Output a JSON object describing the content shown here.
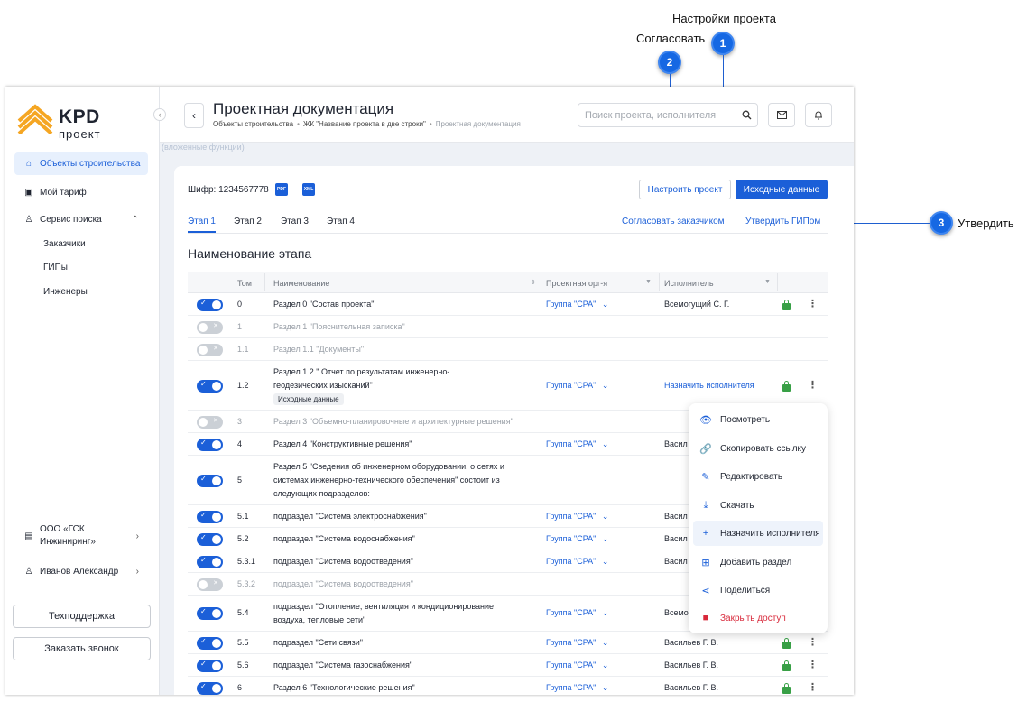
{
  "callouts": {
    "c1": {
      "num": "1",
      "label": "Настройки проекта"
    },
    "c2": {
      "num": "2",
      "label": "Согласовать"
    },
    "c3": {
      "num": "3",
      "label": "Утвердить"
    }
  },
  "sidebar": {
    "logo_text": "KPD",
    "logo_sub": "проект",
    "collapse_icon": "‹",
    "items": [
      {
        "label": "Объекты строительства"
      },
      {
        "label": "Мой тариф"
      },
      {
        "label": "Сервис поиска"
      }
    ],
    "sub_items": [
      "Заказчики",
      "ГИПы",
      "Инженеры"
    ],
    "company": {
      "line1": "ООО «ГСК",
      "line2": "Инжиниринг»"
    },
    "user": "Иванов Александр",
    "support_button": "Техподдержка",
    "call_button": "Заказать звонок"
  },
  "header": {
    "title": "Проектная документация",
    "breadcrumb": {
      "b1": "Объекты строительства",
      "b2": "ЖК \"Название проекта в две строки\"",
      "b3": "Проектная документация"
    },
    "search_placeholder": "Поиск проекта, исполнителя",
    "faded_text": "(вложенные функции)"
  },
  "card": {
    "cipher": "Шифр: 1234567778",
    "pdf_label": "PDF",
    "xml_label": "XML",
    "configure_button": "Настроить проект",
    "source_button": "Исходные данные",
    "tabs": [
      "Этап 1",
      "Этап 2",
      "Этап 3",
      "Этап 4"
    ],
    "agree_link": "Согласовать заказчиком",
    "approve_link": "Утвердить ГИПом",
    "stage_title": "Наименование этапа"
  },
  "table": {
    "headers": {
      "tom": "Том",
      "name": "Наименование",
      "org": "Проектная орг-я",
      "executor": "Исполнитель"
    },
    "sort_icon": "⇕",
    "filter_icon": "▼",
    "kebab": "⋮",
    "rows": [
      {
        "tom": "0",
        "name1": "Раздел 0 \"Состав проекта\"",
        "name2": "",
        "name3": "",
        "org": "Группа \"СРА\"",
        "exec": "Всемогущий С. Г.",
        "on": true
      },
      {
        "tom": "1",
        "name1": "Раздел 1 \"Пояснительная записка\"",
        "name2": "",
        "name3": "",
        "org": "",
        "exec": "",
        "on": false
      },
      {
        "tom": "1.1",
        "name1": "Раздел 1.1 \"Документы\"",
        "name2": "",
        "name3": "",
        "org": "",
        "exec": "",
        "on": false
      },
      {
        "tom": "1.2",
        "name1": "Раздел 1.2 \" Отчет по результатам инженерно-",
        "name2": "геодезических изысканий\"",
        "name3": "",
        "chip": "Исходные данные",
        "org": "Группа \"СРА\"",
        "exec": "Назначить исполнителя",
        "on": true
      },
      {
        "tom": "3",
        "name1": "Раздел 3 \"Объемно-планировочные и архитектурные решения\"",
        "name2": "",
        "name3": "",
        "org": "",
        "exec": "",
        "on": false
      },
      {
        "tom": "4",
        "name1": "Раздел 4 \"Конструктивные решения\"",
        "name2": "",
        "name3": "",
        "org": "Группа \"СРА\"",
        "exec": "Васил",
        "on": true
      },
      {
        "tom": "5",
        "name1": "Раздел 5 \"Сведения об инженерном оборудовании, о сетях и",
        "name2": "системах инженерно-технического обеспечения\" состоит из",
        "name3": "следующих подразделов:",
        "org": "",
        "exec": "",
        "on": true
      },
      {
        "tom": "5.1",
        "name1": "подраздел \"Система электроснабжения\"",
        "name2": "",
        "name3": "",
        "org": "Группа \"СРА\"",
        "exec": "Васил",
        "on": true
      },
      {
        "tom": "5.2",
        "name1": "подраздел \"Система водоснабжения\"",
        "name2": "",
        "name3": "",
        "org": "Группа \"СРА\"",
        "exec": "Васил",
        "on": true
      },
      {
        "tom": "5.3.1",
        "name1": "подраздел \"Система водоотведения\"",
        "name2": "",
        "name3": "",
        "org": "Группа \"СРА\"",
        "exec": "Васил",
        "on": true
      },
      {
        "tom": "5.3.2",
        "name1": "подраздел \"Система водоотведения\"",
        "name2": "",
        "name3": "",
        "org": "",
        "exec": "",
        "on": false
      },
      {
        "tom": "5.4",
        "name1": "подраздел \"Отопление, вентиляция и кондиционирование",
        "name2": "воздуха, тепловые сети\"",
        "name3": "",
        "org": "Группа \"СРА\"",
        "exec": "Всемо",
        "on": true
      },
      {
        "tom": "5.5",
        "name1": "подраздел \"Сети связи\"",
        "name2": "",
        "name3": "",
        "org": "Группа \"СРА\"",
        "exec": "Васильев Г. В.",
        "on": true
      },
      {
        "tom": "5.6",
        "name1": "подраздел \"Система газоснабжения\"",
        "name2": "",
        "name3": "",
        "org": "Группа \"СРА\"",
        "exec": "Васильев Г. В.",
        "on": true
      },
      {
        "tom": "6",
        "name1": "Раздел 6 \"Технологические решения\"",
        "name2": "",
        "name3": "",
        "org": "Группа \"СРА\"",
        "exec": "Васильев Г. В.",
        "on": true
      }
    ]
  },
  "menu": {
    "items": [
      {
        "label": "Посмотреть",
        "icon": "eye-icon"
      },
      {
        "label": "Скопировать ссылку",
        "icon": "link-icon"
      },
      {
        "label": "Редактировать",
        "icon": "pencil-icon"
      },
      {
        "label": "Скачать",
        "icon": "download-icon"
      },
      {
        "label": "Назначить исполнителя",
        "icon": "plus-icon"
      },
      {
        "label": "Добавить раздел",
        "icon": "file-plus-icon"
      },
      {
        "label": "Поделиться",
        "icon": "share-icon"
      },
      {
        "label": "Закрыть доступ",
        "icon": "lock-icon"
      }
    ]
  },
  "colors": {
    "accent": "#1b5fd8",
    "callout": "#1668e3",
    "lock_green": "#38a046",
    "danger": "#d8283a"
  }
}
